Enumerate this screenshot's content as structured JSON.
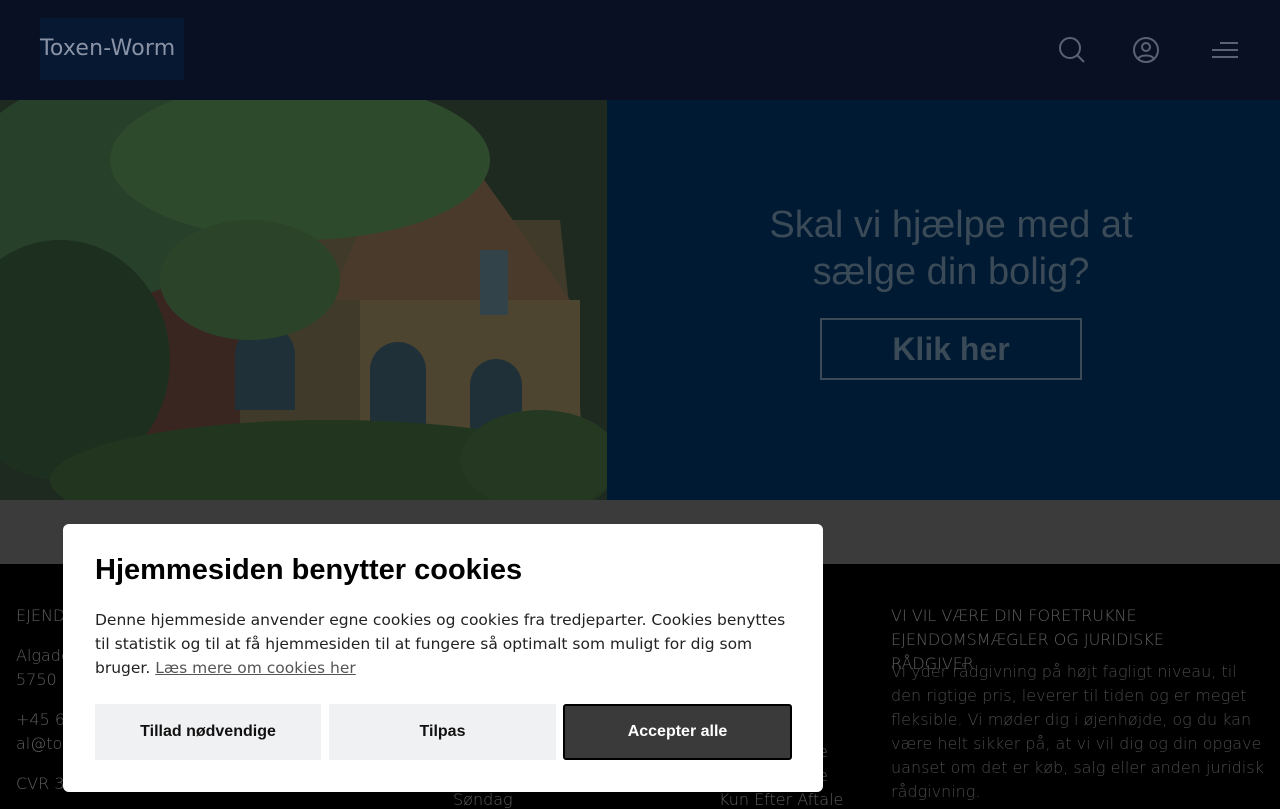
{
  "header": {
    "logo_text": "Toxen-Worm",
    "icons": [
      "search-icon",
      "user-icon",
      "menu-icon"
    ]
  },
  "hero": {
    "promo_line1": "Skal vi hjælpe med at",
    "promo_line2": "sælge din bolig?",
    "promo_button": "Klik her"
  },
  "footer": {
    "col1_heading": "EJEND",
    "col1_address1": "Algade",
    "col1_address2": "5750 R",
    "col1_phone": "+45 62",
    "col1_email": "al@tox",
    "col1_cvr": "CVR 30",
    "col2_day": "Søndag",
    "col3_row1": ")",
    "col3_row2": ")",
    "col3_row3": ")",
    "col3_row4": ")",
    "col3_row5": "e",
    "col3_row6": "e",
    "col3_last": "Kun Efter Aftale",
    "col4_heading": "VI VIL VÆRE DIN FORETRUKNE EJENDOMSMÆGLER OG JURIDISKE RÅDGIVER",
    "col4_body": "Vi yder rådgivning på højt fagligt niveau, til den rigtige pris, leverer til tiden og er meget fleksible. Vi møder dig i øjenhøjde, og du kan være helt sikker på, at vi vil dig og din opgave uanset om det er køb, salg eller anden juridisk rådgivning."
  },
  "cookie_dialog": {
    "title": "Hjemmesiden benytter cookies",
    "body": "Denne hjemmeside anvender egne cookies og cookies fra tredjeparter. Cookies benyttes til statistik og til at få hjemmesiden til at fungere så optimalt som muligt for dig som bruger.",
    "link": "Læs mere om cookies her",
    "btn_necessary": "Tillad nødvendige",
    "btn_customize": "Tilpas",
    "btn_accept_all": "Accepter alle"
  },
  "colors": {
    "header_bg": "#0a1024",
    "promo_bg": "#001a33",
    "accept_bg": "#3a3a3a"
  }
}
